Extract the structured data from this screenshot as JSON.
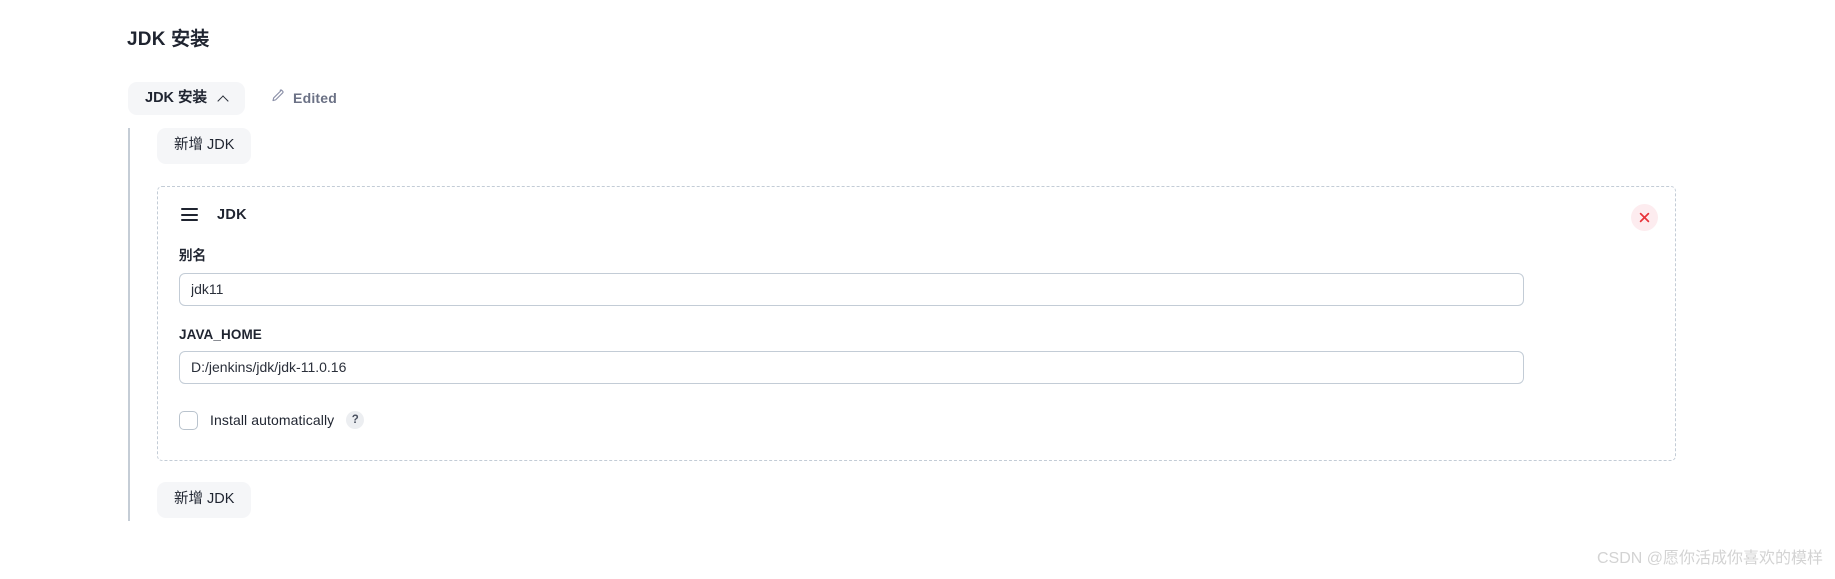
{
  "page": {
    "title": "JDK 安装"
  },
  "section": {
    "chip_label": "JDK 安装",
    "chevron_icon": "chevron-up-icon",
    "edited_icon": "pencil-icon",
    "edited_label": "Edited"
  },
  "toolbar": {
    "add_top_label": "新增 JDK",
    "add_bottom_label": "新增 JDK"
  },
  "card": {
    "drag_icon": "drag-handle-icon",
    "title": "JDK",
    "close_icon": "close-icon",
    "fields": [
      {
        "label": "别名",
        "value": "jdk11",
        "placeholder": ""
      },
      {
        "label": "JAVA_HOME",
        "value": "D:/jenkins/jdk/jdk-11.0.16",
        "placeholder": ""
      }
    ],
    "checkbox": {
      "label": "Install automatically",
      "checked": false,
      "help_label": "?"
    }
  },
  "watermark": {
    "text": "CSDN @愿你活成你喜欢的模样"
  },
  "colors": {
    "accent_close": "#e8333a",
    "close_bg": "#fdecef",
    "chip_bg": "#f5f6f8",
    "dashed_border": "#c3ccd6",
    "rail": "#c5cdd6",
    "text_primary": "#1f2430",
    "text_muted": "#6b7185",
    "watermark": "#d3d3d3"
  }
}
